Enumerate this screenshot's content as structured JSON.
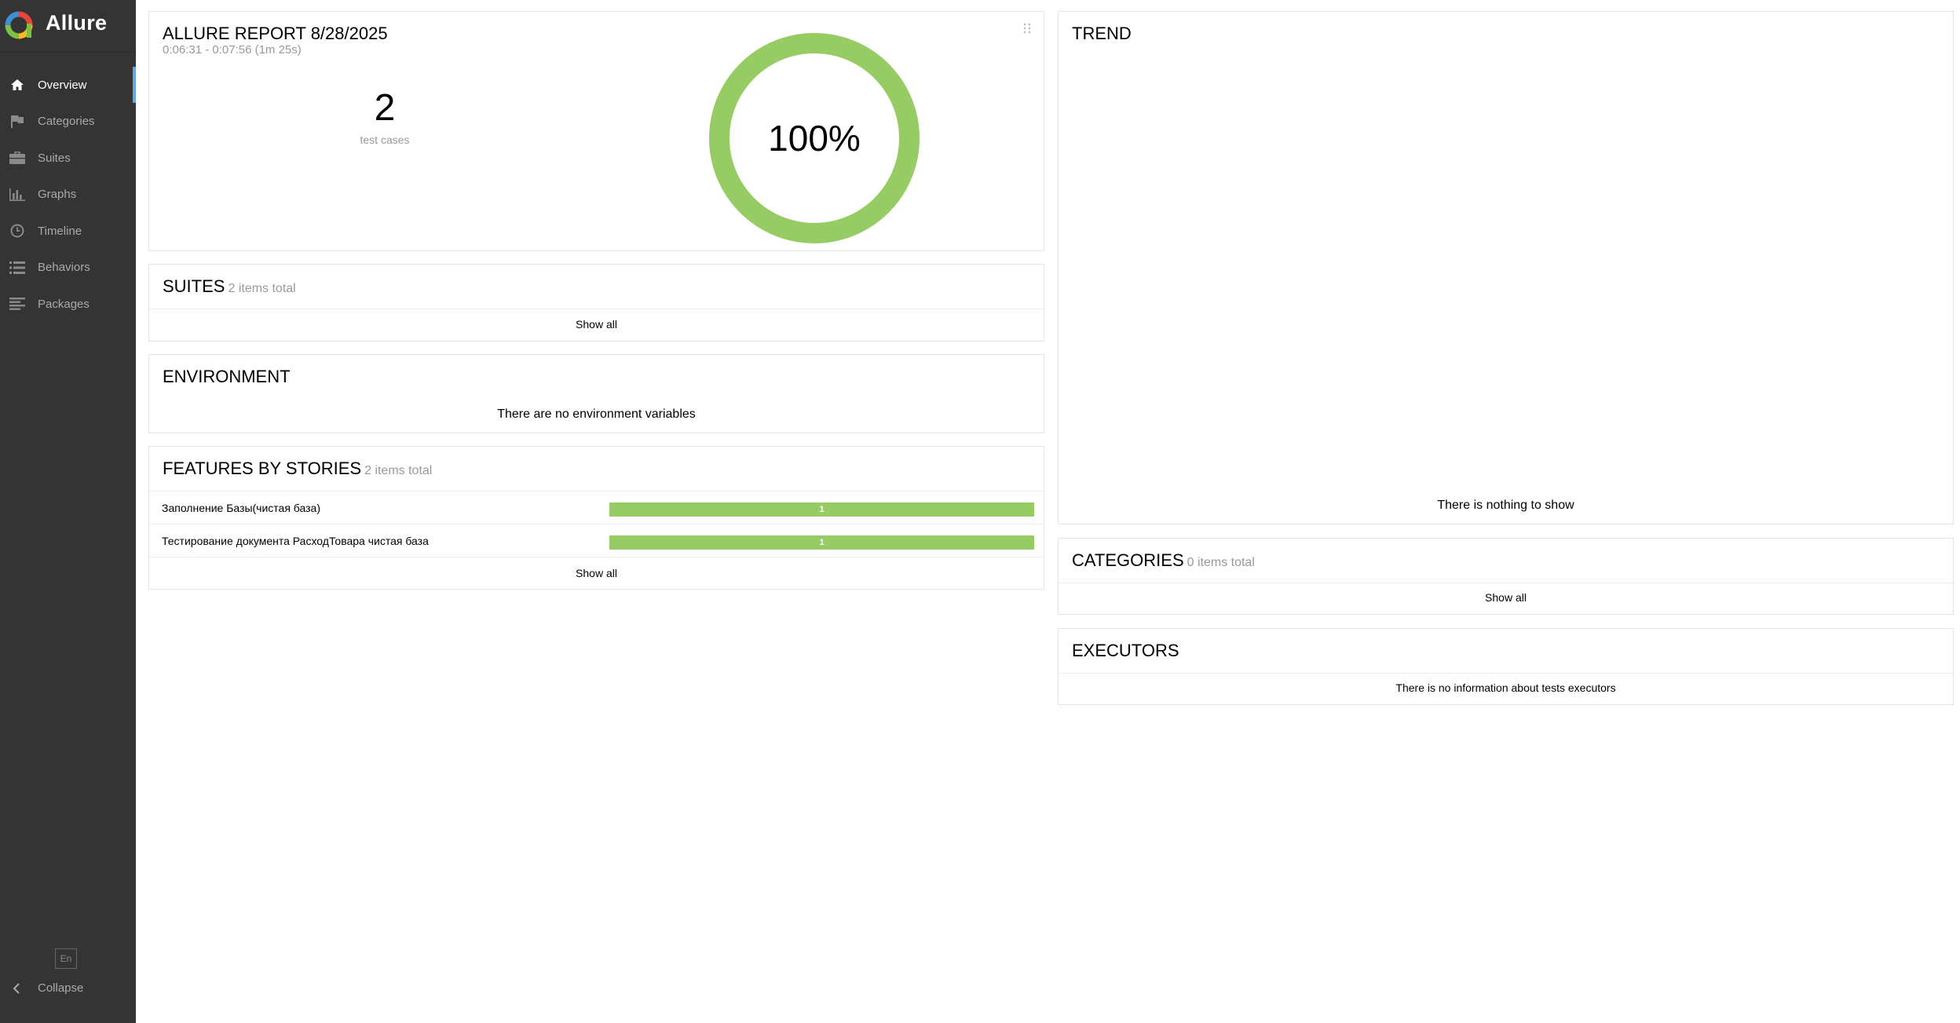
{
  "app": {
    "name": "Allure"
  },
  "sidebar": {
    "items": [
      {
        "label": "Overview",
        "icon": "home-icon",
        "active": true
      },
      {
        "label": "Categories",
        "icon": "flag-icon",
        "active": false
      },
      {
        "label": "Suites",
        "icon": "briefcase-icon",
        "active": false
      },
      {
        "label": "Graphs",
        "icon": "bar-chart-icon",
        "active": false
      },
      {
        "label": "Timeline",
        "icon": "clock-icon",
        "active": false
      },
      {
        "label": "Behaviors",
        "icon": "list-icon",
        "active": false
      },
      {
        "label": "Packages",
        "icon": "align-left-icon",
        "active": false
      }
    ],
    "language": "En",
    "collapse_label": "Collapse"
  },
  "summary": {
    "title": "ALLURE REPORT 8/28/2025",
    "time_range": "0:06:31 - 0:07:56 (1m 25s)",
    "test_count": "2",
    "test_count_label": "test cases",
    "pass_rate_label": "100%",
    "pass_rate": 1.0
  },
  "suites": {
    "title": "SUITES",
    "count_label": "2 items total",
    "show_all": "Show all"
  },
  "environment": {
    "title": "ENVIRONMENT",
    "empty": "There are no environment variables"
  },
  "features": {
    "title": "FEATURES BY STORIES",
    "count_label": "2 items total",
    "rows": [
      {
        "name": "Заполнение Базы(чистая база)",
        "passed": "1"
      },
      {
        "name": "Тестирование документа РасходТовара чистая база",
        "passed": "1"
      }
    ],
    "show_all": "Show all"
  },
  "trend": {
    "title": "TREND",
    "empty": "There is nothing to show"
  },
  "categories": {
    "title": "CATEGORIES",
    "count_label": "0 items total",
    "show_all": "Show all"
  },
  "executors": {
    "title": "EXECUTORS",
    "empty": "There is no information about tests executors"
  },
  "colors": {
    "sidebar_bg": "#343434",
    "accent": "#65a8e0",
    "passed": "#97cc64"
  }
}
